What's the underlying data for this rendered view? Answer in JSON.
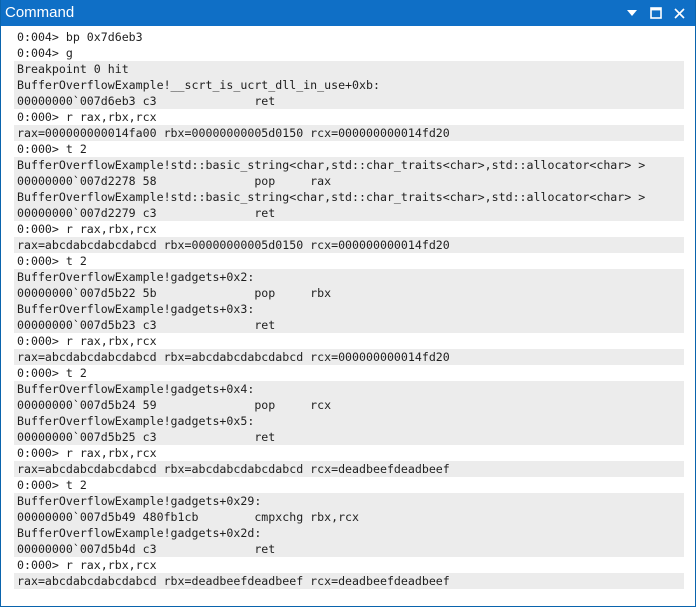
{
  "window": {
    "title": "Command",
    "accent_color": "#0f6fc6",
    "icons": [
      "dropdown-arrow-icon",
      "maximize-icon",
      "close-icon"
    ]
  },
  "blocks": [
    {
      "shaded": false,
      "lines": [
        "0:004> bp 0x7d6eb3"
      ]
    },
    {
      "shaded": false,
      "lines": [
        "0:004> g"
      ]
    },
    {
      "shaded": true,
      "lines": [
        "Breakpoint 0 hit",
        "BufferOverflowExample!__scrt_is_ucrt_dll_in_use+0xb:",
        "00000000`007d6eb3 c3              ret"
      ]
    },
    {
      "shaded": false,
      "lines": [
        "0:000> r rax,rbx,rcx"
      ]
    },
    {
      "shaded": true,
      "lines": [
        "rax=000000000014fa00 rbx=00000000005d0150 rcx=000000000014fd20"
      ]
    },
    {
      "shaded": false,
      "lines": [
        "0:000> t 2"
      ]
    },
    {
      "shaded": true,
      "lines": [
        "BufferOverflowExample!std::basic_string<char,std::char_traits<char>,std::allocator<char> >",
        "00000000`007d2278 58              pop     rax",
        "BufferOverflowExample!std::basic_string<char,std::char_traits<char>,std::allocator<char> >",
        "00000000`007d2279 c3              ret"
      ]
    },
    {
      "shaded": false,
      "lines": [
        "0:000> r rax,rbx,rcx"
      ]
    },
    {
      "shaded": true,
      "lines": [
        "rax=abcdabcdabcdabcd rbx=00000000005d0150 rcx=000000000014fd20"
      ]
    },
    {
      "shaded": false,
      "lines": [
        "0:000> t 2"
      ]
    },
    {
      "shaded": true,
      "lines": [
        "BufferOverflowExample!gadgets+0x2:",
        "00000000`007d5b22 5b              pop     rbx",
        "BufferOverflowExample!gadgets+0x3:",
        "00000000`007d5b23 c3              ret"
      ]
    },
    {
      "shaded": false,
      "lines": [
        "0:000> r rax,rbx,rcx"
      ]
    },
    {
      "shaded": true,
      "lines": [
        "rax=abcdabcdabcdabcd rbx=abcdabcdabcdabcd rcx=000000000014fd20"
      ]
    },
    {
      "shaded": false,
      "lines": [
        "0:000> t 2"
      ]
    },
    {
      "shaded": true,
      "lines": [
        "BufferOverflowExample!gadgets+0x4:",
        "00000000`007d5b24 59              pop     rcx",
        "BufferOverflowExample!gadgets+0x5:",
        "00000000`007d5b25 c3              ret"
      ]
    },
    {
      "shaded": false,
      "lines": [
        "0:000> r rax,rbx,rcx"
      ]
    },
    {
      "shaded": true,
      "lines": [
        "rax=abcdabcdabcdabcd rbx=abcdabcdabcdabcd rcx=deadbeefdeadbeef"
      ]
    },
    {
      "shaded": false,
      "lines": [
        "0:000> t 2"
      ]
    },
    {
      "shaded": true,
      "lines": [
        "BufferOverflowExample!gadgets+0x29:",
        "00000000`007d5b49 480fb1cb        cmpxchg rbx,rcx",
        "BufferOverflowExample!gadgets+0x2d:",
        "00000000`007d5b4d c3              ret"
      ]
    },
    {
      "shaded": false,
      "lines": [
        "0:000> r rax,rbx,rcx"
      ]
    },
    {
      "shaded": true,
      "lines": [
        "rax=abcdabcdabcdabcd rbx=deadbeefdeadbeef rcx=deadbeefdeadbeef"
      ]
    }
  ]
}
